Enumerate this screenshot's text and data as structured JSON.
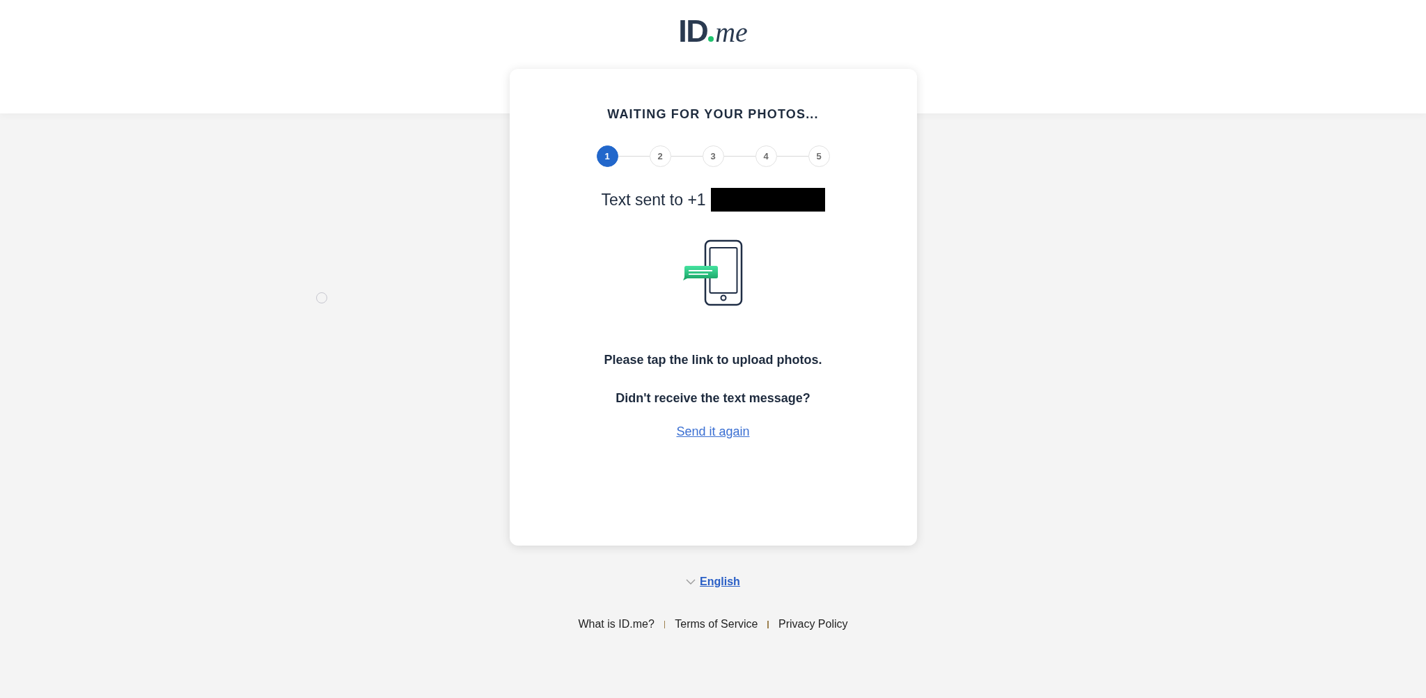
{
  "logo": {
    "left": "ID",
    "right": "me"
  },
  "card": {
    "title": "WAITING FOR YOUR PHOTOS...",
    "steps": [
      {
        "label": "1",
        "selected": true
      },
      {
        "label": "2",
        "selected": false
      },
      {
        "label": "3",
        "selected": false
      },
      {
        "label": "4",
        "selected": false
      },
      {
        "label": "5",
        "selected": false
      }
    ],
    "sent_to": {
      "text": "Text sent to +1",
      "redacted": true
    },
    "instruction": "Please tap the link to upload photos.",
    "question": "Didn't receive the text message?",
    "resend_link": "Send it again"
  },
  "language": {
    "label": "English"
  },
  "footer_links": [
    "What is ID.me?",
    "Terms of Service",
    "Privacy Policy"
  ]
}
